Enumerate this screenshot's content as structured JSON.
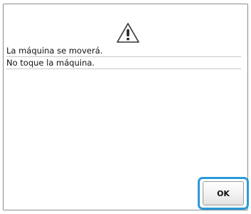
{
  "dialog": {
    "icon": "warning-triangle-icon",
    "message_lines": [
      "La máquina se moverá.",
      "No toque la máquina."
    ],
    "ok_label": "OK"
  },
  "colors": {
    "highlight": "#2a9ad6",
    "frame_border": "#8c8c8c",
    "text": "#111111"
  }
}
